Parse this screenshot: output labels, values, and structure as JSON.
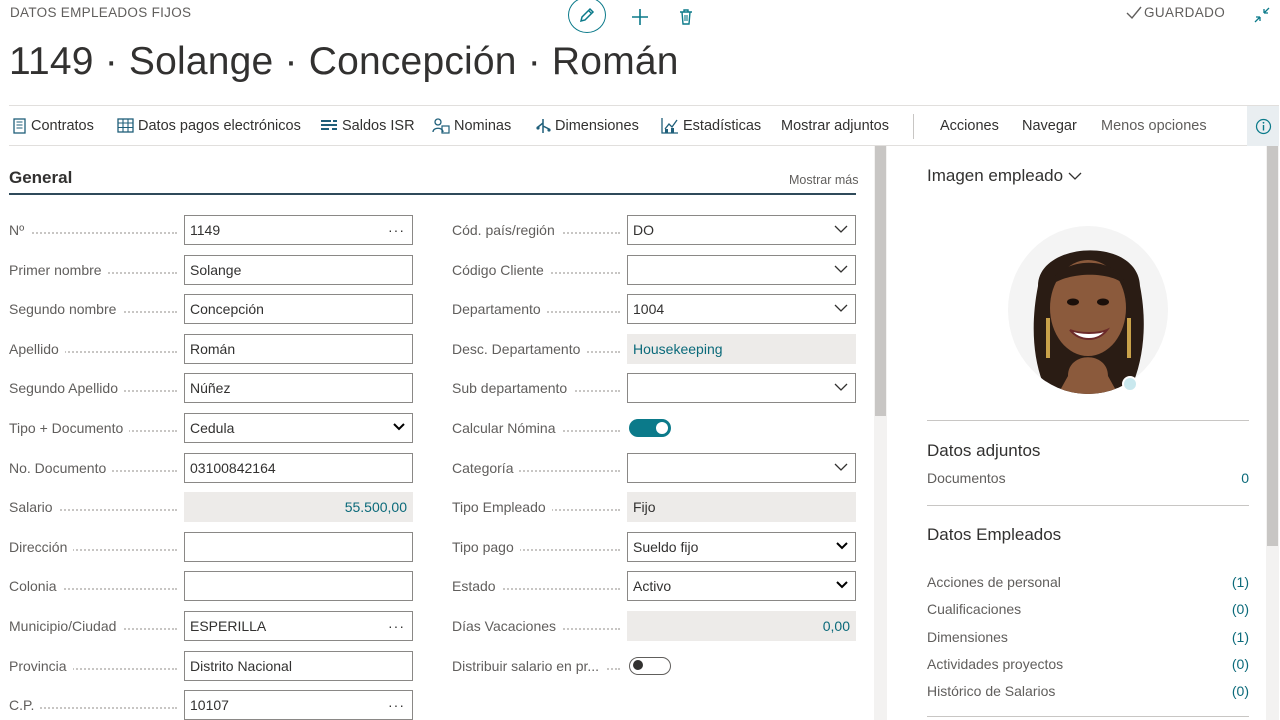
{
  "header": {
    "caption": "DATOS EMPLEADOS FIJOS",
    "title": "1149 · Solange · Concepción · Román",
    "saved_label": "GUARDADO",
    "edit_icon": "pencil-icon",
    "add_icon": "plus-icon",
    "delete_icon": "trash-icon",
    "collapse_icon": "collapse-icon"
  },
  "actionbar": {
    "items": [
      {
        "label": "Contratos",
        "icon": "contracts-icon"
      },
      {
        "label": "Datos pagos electrónicos",
        "icon": "table-icon"
      },
      {
        "label": "Saldos ISR",
        "icon": "balance-icon"
      },
      {
        "label": "Nominas",
        "icon": "payroll-icon"
      },
      {
        "label": "Dimensiones",
        "icon": "dimensions-icon"
      },
      {
        "label": "Estadísticas",
        "icon": "statistics-icon"
      },
      {
        "label": "Mostrar adjuntos",
        "icon": ""
      },
      {
        "label": "Acciones",
        "icon": ""
      },
      {
        "label": "Navegar",
        "icon": ""
      },
      {
        "label": "Menos opciones",
        "icon": ""
      }
    ]
  },
  "general": {
    "title": "General",
    "show_more": "Mostrar más",
    "left": [
      {
        "label": "Nº",
        "value": "1149",
        "kind": "lookup"
      },
      {
        "label": "Primer nombre",
        "value": "Solange",
        "kind": "text"
      },
      {
        "label": "Segundo nombre",
        "value": "Concepción",
        "kind": "text"
      },
      {
        "label": "Apellido",
        "value": "Román",
        "kind": "text"
      },
      {
        "label": "Segundo Apellido",
        "value": "Núñez",
        "kind": "text"
      },
      {
        "label": "Tipo + Documento",
        "value": "Cedula",
        "kind": "select"
      },
      {
        "label": "No. Documento",
        "value": "03100842164",
        "kind": "text"
      },
      {
        "label": "Salario",
        "value": "55.500,00",
        "kind": "readonly-num"
      },
      {
        "label": "Dirección",
        "value": "",
        "kind": "text"
      },
      {
        "label": "Colonia",
        "value": "",
        "kind": "text"
      },
      {
        "label": "Municipio/Ciudad",
        "value": "ESPERILLA",
        "kind": "lookup"
      },
      {
        "label": "Provincia",
        "value": "Distrito Nacional",
        "kind": "text"
      },
      {
        "label": "C.P.",
        "value": "10107",
        "kind": "lookup"
      }
    ],
    "right": [
      {
        "label": "Cód. país/región",
        "value": "DO",
        "kind": "dropdown"
      },
      {
        "label": "Código Cliente",
        "value": "",
        "kind": "dropdown"
      },
      {
        "label": "Departamento",
        "value": "1004",
        "kind": "dropdown"
      },
      {
        "label": "Desc. Departamento",
        "value": "Housekeeping",
        "kind": "readonly-link"
      },
      {
        "label": "Sub departamento",
        "value": "",
        "kind": "dropdown"
      },
      {
        "label": "Calcular Nómina",
        "value": "",
        "kind": "toggle-on"
      },
      {
        "label": "Categoría",
        "value": "",
        "kind": "dropdown"
      },
      {
        "label": "Tipo Empleado",
        "value": "Fijo",
        "kind": "readonly"
      },
      {
        "label": "Tipo pago",
        "value": "Sueldo fijo",
        "kind": "select"
      },
      {
        "label": "Estado",
        "value": "Activo",
        "kind": "select"
      },
      {
        "label": "Días Vacaciones",
        "value": "0,00",
        "kind": "readonly-num"
      },
      {
        "label": "Distribuir salario en pr...",
        "value": "",
        "kind": "toggle-off"
      }
    ]
  },
  "factbox": {
    "image_title": "Imagen empleado",
    "attachments_title": "Datos adjuntos",
    "attachments": [
      {
        "label": "Documentos",
        "count": "0"
      }
    ],
    "employee_title": "Datos Empleados",
    "employee_items": [
      {
        "label": "Acciones de personal",
        "count": "(1)"
      },
      {
        "label": "Cualificaciones",
        "count": "(0)"
      },
      {
        "label": "Dimensiones",
        "count": "(1)"
      },
      {
        "label": "Actividades proyectos",
        "count": "(0)"
      },
      {
        "label": "Histórico de Salarios",
        "count": "(0)"
      }
    ]
  },
  "colors": {
    "accent": "#0b7a8a",
    "link": "#0b6a7a",
    "readonly_bg": "#edebe9"
  }
}
